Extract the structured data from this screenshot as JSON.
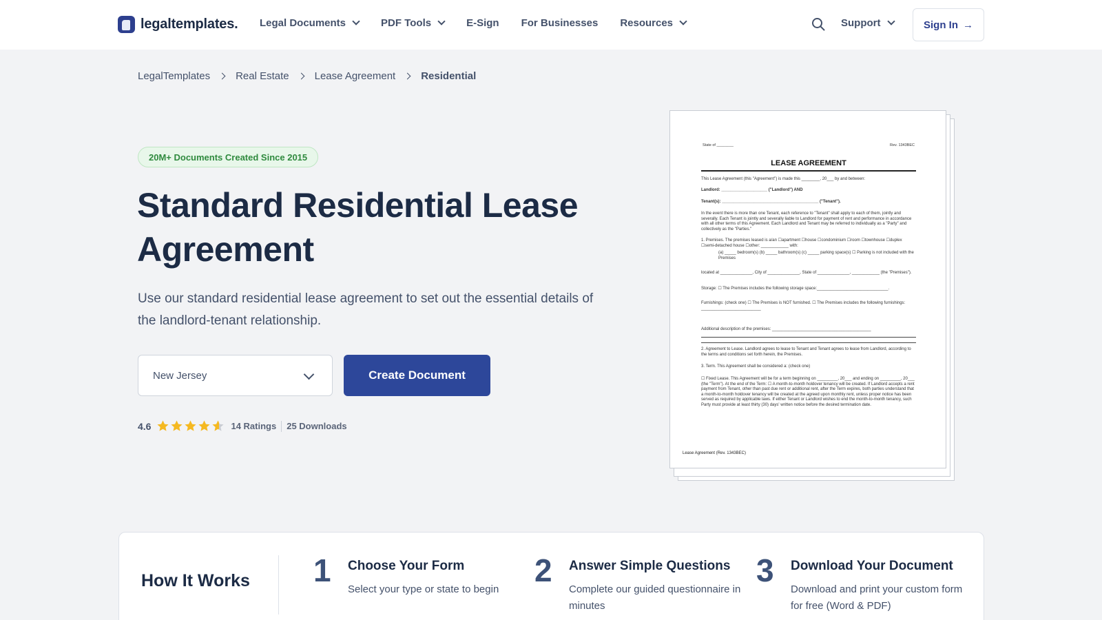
{
  "header": {
    "logo_text": "legaltemplates.",
    "nav": [
      {
        "label": "Legal Documents"
      },
      {
        "label": "PDF Tools"
      },
      {
        "label": "E-Sign"
      },
      {
        "label": "For Businesses"
      },
      {
        "label": "Resources"
      }
    ],
    "support_label": "Support",
    "signin_label": "Sign In",
    "signin_arrow": "→"
  },
  "breadcrumb": [
    "LegalTemplates",
    "Real Estate",
    "Lease Agreement",
    "Residential"
  ],
  "hero": {
    "badge": "20M+ Documents Created Since 2015",
    "title": "Standard Residential Lease Agreement",
    "subtitle": "Use our standard residential lease agreement to set out the essential details of the landlord-tenant relationship.",
    "state_value": "New Jersey",
    "cta_label": "Create Document"
  },
  "rating": {
    "value": "4.6",
    "stars_filled_fraction": 0.92,
    "ratings_count": "14 Ratings",
    "downloads": "25 Downloads"
  },
  "document_preview": {
    "state_label": "State of ________",
    "rev_label": "Rev. 1343BEC",
    "title": "LEASE AGREEMENT",
    "intro": "This Lease Agreement (this \"Agreement\") is made this ________, 20___ by and between:",
    "landlord": "Landlord: ____________________ (\"Landlord\") AND",
    "tenants": "Tenant(s): __________________________________________ (\"Tenant\").",
    "para1": "In the event there is more than one Tenant, each reference to \"Tenant\" shall apply to each of them, jointly and severally. Each Tenant is jointly and severally liable to Landlord for payment of rent and performance in accordance with all other terms of this Agreement. Each Landlord and Tenant may be referred to individually as a \"Party\" and collectively as the \"Parties.\"",
    "premises": "1. Premises. The premises leased is a/an ☐apartment ☐house ☐condominium ☐room ☐townhouse ☐duplex ☐semi-detached house ☐other: ____________ with:",
    "premises_items": "(a) _____ bedroom(s)   (b) _____ bathroom(s)   (c) _____ parking space(s) ☐ Parking is not included with the Premises",
    "located": "located at ______________, City of ______________, State of ______________, ____________ (the \"Premises\").",
    "storage": "Storage: ☐ The Premises includes the following storage space:_______________________________.",
    "furnishings": "Furnishings: (check one) ☐ The Premises is NOT furnished. ☐ The Premises includes the following furnishings: __________________________",
    "additional": "Additional description of the premises: ___________________________________________",
    "agreement": "2. Agreement to Lease. Landlord agrees to lease to Tenant and Tenant agrees to lease from Landlord, according to the terms and conditions set forth herein, the Premises.",
    "term": "3. Term. This Agreement shall be considered a: (check one)",
    "fixed": "☐ Fixed Lease. This Agreement will be for a term beginning on _________, 20___ and ending on _________, 20___ (the \"Term\"). At the end of the Term: ☐ A month-to-month holdover tenancy will be created. If Landlord accepts a rent payment from Tenant, other than past due rent or additional rent, after the Term expires, both parties understand that a month-to-month holdover tenancy will be created at the agreed upon monthly rent, unless proper notice has been served as required by applicable laws. If either Tenant or Landlord wishes to end the month-to-month tenancy, such Party must provide at least thirty (30) days' written notice before the desired termination date.",
    "footer": "Lease Agreement (Rev. 1343BEC)"
  },
  "how_it_works": {
    "title": "How It Works",
    "steps": [
      {
        "num": "1",
        "title": "Choose Your Form",
        "desc": "Select your type or state to begin"
      },
      {
        "num": "2",
        "title": "Answer Simple Questions",
        "desc": "Complete our guided questionnaire in minutes"
      },
      {
        "num": "3",
        "title": "Download Your Document",
        "desc": "Download and print your custom form for free (Word & PDF)"
      }
    ]
  },
  "colors": {
    "brand": "#2d479a",
    "text_dark": "#1c2b45",
    "star": "#f5b921",
    "badge_green": "#2f8a3e"
  }
}
